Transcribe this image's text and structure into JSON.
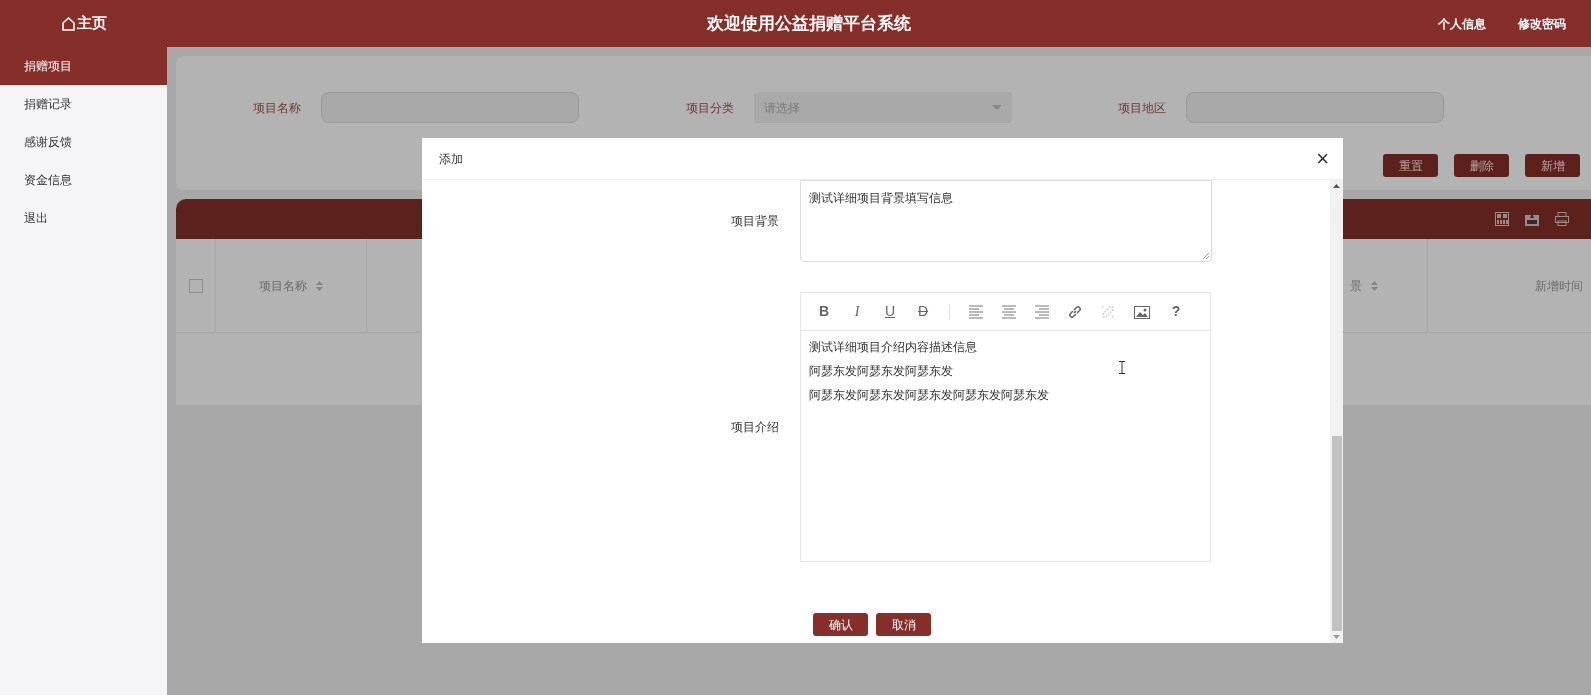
{
  "header": {
    "home": "主页",
    "title": "欢迎使用公益捐赠平台系统",
    "links": [
      "个人信息",
      "修改密码"
    ]
  },
  "sidebar": {
    "items": [
      {
        "label": "捐赠项目",
        "selected": true
      },
      {
        "label": "捐赠记录",
        "selected": false
      },
      {
        "label": "感谢反馈",
        "selected": false
      },
      {
        "label": "资金信息",
        "selected": false
      },
      {
        "label": "退出",
        "selected": false
      }
    ]
  },
  "search": {
    "fields": [
      {
        "kind": "input",
        "label": "项目名称"
      },
      {
        "kind": "select",
        "label": "项目分类",
        "placeholder": "请选择"
      },
      {
        "kind": "input",
        "label": "项目地区"
      }
    ],
    "buttons": [
      "重置",
      "删除",
      "新增"
    ]
  },
  "table": {
    "select_all_checked": false,
    "columns": [
      {
        "label": "项目名称"
      },
      {
        "label": "景"
      },
      {
        "label": "新增时间"
      }
    ]
  },
  "dialog": {
    "title": "添加",
    "close": "×",
    "fields": [
      {
        "kind": "textarea",
        "label": "项目背景",
        "value": "测试详细项目背景填写信息"
      },
      {
        "kind": "editor",
        "label": "项目介绍",
        "toolbar": [
          {
            "kind": "bold",
            "label": "B"
          },
          {
            "kind": "italic",
            "label": "I"
          },
          {
            "kind": "underline",
            "label": "U"
          },
          {
            "kind": "strike",
            "label": "D"
          },
          {
            "kind": "separator"
          },
          {
            "kind": "align-left"
          },
          {
            "kind": "align-center"
          },
          {
            "kind": "align-right"
          },
          {
            "kind": "link"
          },
          {
            "kind": "unlink"
          },
          {
            "kind": "image"
          },
          {
            "kind": "help",
            "label": "?"
          }
        ],
        "lines": [
          "测试详细项目介绍内容描述信息",
          "阿瑟东发阿瑟东发阿瑟东发",
          "阿瑟东发阿瑟东发阿瑟东发阿瑟东发阿瑟东发"
        ]
      }
    ],
    "buttons": [
      "确认",
      "取消"
    ]
  }
}
